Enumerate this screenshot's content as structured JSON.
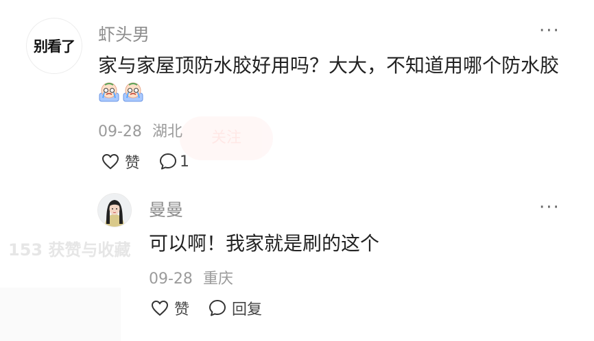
{
  "background": {
    "follow_button_text": "关注",
    "stats_text": "153 获赞与收藏"
  },
  "comment": {
    "avatar_text": "别看了",
    "username": "虾头男",
    "text": "家与家屋顶防水胶好用吗？大大，不知道用哪个防水胶",
    "stickers": [
      "crying-face-sticker",
      "crying-face-sticker"
    ],
    "date": "09-28",
    "location": "湖北",
    "like_label": "赞",
    "reply_count": "1",
    "more_label": "···"
  },
  "reply": {
    "username": "曼曼",
    "text": "可以啊！我家就是刷的这个",
    "date": "09-28",
    "location": "重庆",
    "like_label": "赞",
    "reply_label": "回复",
    "more_label": "···"
  },
  "colors": {
    "text_primary": "#222222",
    "text_secondary": "#8d8d8d",
    "meta": "#9b9b9b"
  }
}
